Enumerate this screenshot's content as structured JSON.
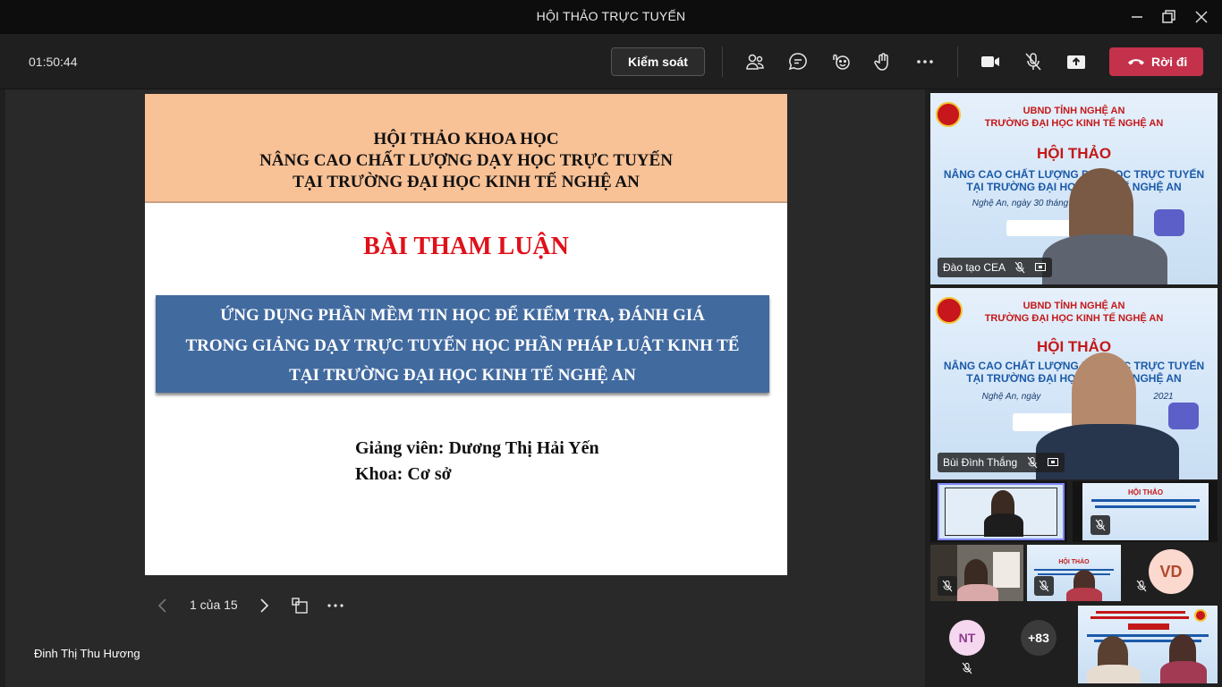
{
  "window": {
    "title": "HỘI THẢO TRỰC TUYẾN"
  },
  "toolbar": {
    "timer": "01:50:44",
    "control_label": "Kiểm soát",
    "leave_label": "Rời đi"
  },
  "slide": {
    "header_lines": [
      "HỘI THẢO KHOA HỌC",
      "NÂNG CAO CHẤT LƯỢNG DẠY HỌC TRỰC TUYẾN",
      "TẠI TRƯỜNG ĐẠI HỌC KINH TẾ NGHỆ AN"
    ],
    "title": "BÀI THAM LUẬN",
    "topic_lines": [
      "ỨNG DỤNG PHẦN MỀM  TIN HỌC ĐỂ KIỂM TRA, ĐÁNH GIÁ",
      "TRONG GIẢNG DẠY TRỰC TUYẾN HỌC PHẦN PHÁP LUẬT KINH TẾ",
      "TẠI TRƯỜNG ĐẠI HỌC KINH TẾ NGHỆ AN"
    ],
    "lecturer": "Giảng viên:  Dương Thị Hải Yến",
    "faculty": "Khoa: Cơ sở"
  },
  "pager": {
    "text": "1 của 15"
  },
  "presenter": {
    "name": "Đinh Thị Thu Hương"
  },
  "participants": {
    "tile1": {
      "name": "Đào tạo CEA",
      "banner_lines": [
        "UBND TỈNH NGHỆ AN",
        "TRƯỜNG ĐẠI HỌC KINH TẾ NGHỆ AN",
        "HỘI THẢO",
        "NÂNG CAO CHẤT LƯỢNG DẠY HỌC TRỰC TUYẾN",
        "TẠI TRƯỜNG ĐẠI HỌC KINH TẾ NGHỆ AN",
        "Nghệ An, ngày 30 tháng"
      ]
    },
    "tile2": {
      "name": "Bùi Đình Thắng",
      "banner_lines": [
        "UBND TỈNH NGHỆ AN",
        "TRƯỜNG ĐẠI HỌC KINH TẾ NGHỆ AN",
        "HỘI THẢO",
        "NÂNG CAO CHẤT LƯỢNG DẠY HỌC TRỰC TUYẾN",
        "TẠI TRƯỜNG ĐẠI HỌC KINH TẾ NGHỆ AN",
        "Nghệ An, ngày",
        "2021"
      ]
    },
    "small_banner_title": "HỘI THẢO",
    "avatar_vd": "VD",
    "avatar_nt": "NT",
    "overflow_count": "+83"
  },
  "colors": {
    "accent_red": "#c4314b",
    "slide_header": "#f8c196",
    "slide_box": "#416a9f",
    "slide_title": "#e0101a"
  },
  "icons": [
    "close-icon",
    "maximize-icon",
    "minimize-icon",
    "people-icon",
    "chat-icon",
    "reactions-icon",
    "raise-hand-icon",
    "more-icon",
    "camera-icon",
    "mic-muted-icon",
    "share-icon",
    "phone-hangup-icon",
    "chevron-left-icon",
    "chevron-right-icon",
    "grid-view-icon"
  ]
}
